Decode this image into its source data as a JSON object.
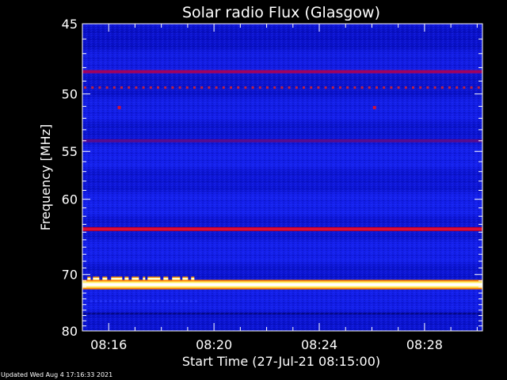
{
  "chart_data": {
    "type": "heatmap",
    "title": "Solar radio Flux (Glasgow)",
    "xlabel": "Start Time (27-Jul-21 08:15:00)",
    "ylabel": "Frequency [MHz]",
    "x_ticks": [
      "08:16",
      "08:20",
      "08:24",
      "08:28"
    ],
    "x_tick_minutes": [
      16,
      20,
      24,
      28
    ],
    "x_range_minutes": [
      15,
      30.2
    ],
    "y_ticks": [
      45,
      50,
      55,
      60,
      70,
      80
    ],
    "y_range": [
      45,
      80
    ],
    "y_scale": "reciprocal",
    "emission_bands": [
      {
        "freq_mhz": 48.3,
        "level": "medium"
      },
      {
        "freq_mhz": 49.5,
        "level": "dotted-medium"
      },
      {
        "freq_mhz": 54.0,
        "level": "weak"
      },
      {
        "freq_mhz": 63.6,
        "level": "strong"
      },
      {
        "freq_mhz": 70.7,
        "level": "intermittent-high",
        "minute_range": [
          15.1,
          19.3
        ]
      },
      {
        "freq_mhz": 71.6,
        "level": "very-high"
      },
      {
        "freq_mhz": 74.4,
        "level": "faint",
        "minute_range": [
          15.3,
          19.3
        ]
      }
    ],
    "point_sources": [
      {
        "minute": 16.4,
        "freq_mhz": 51.1
      },
      {
        "minute": 26.1,
        "freq_mhz": 51.1
      }
    ]
  },
  "footer": "Updated Wed Aug  4 17:16:33 2021"
}
